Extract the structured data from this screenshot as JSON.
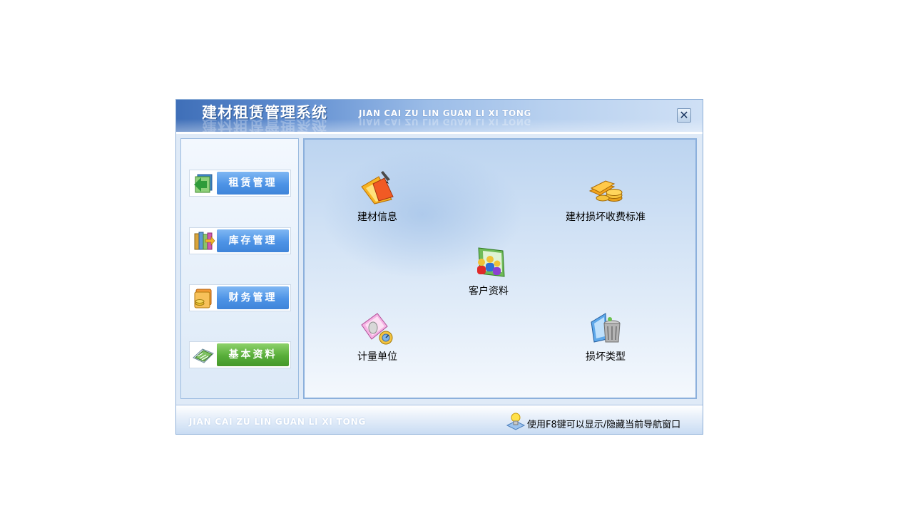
{
  "window": {
    "title_cn": "建材租赁管理系统",
    "title_en": "JIAN CAI ZU LIN GUAN LI XI TONG",
    "close_symbol": "✕"
  },
  "sidebar": {
    "items": [
      {
        "label": "租赁管理",
        "icon": "rental-icon",
        "active": false
      },
      {
        "label": "库存管理",
        "icon": "inventory-icon",
        "active": false
      },
      {
        "label": "财务管理",
        "icon": "finance-icon",
        "active": false
      },
      {
        "label": "基本资料",
        "icon": "basic-data-icon",
        "active": true
      }
    ]
  },
  "content": {
    "items": [
      {
        "label": "建材信息",
        "icon": "building-material-icon"
      },
      {
        "label": "建材损坏收费标准",
        "icon": "coins-icon"
      },
      {
        "label": "客户资料",
        "icon": "customers-icon"
      },
      {
        "label": "计量单位",
        "icon": "measure-unit-icon"
      },
      {
        "label": "损坏类型",
        "icon": "trash-icon"
      }
    ]
  },
  "footer": {
    "watermark": "JIAN CAI ZU LIN GUAN LI XI TONG",
    "tip": "使用F8键可以显示/隐藏当前导航窗口",
    "tip_icon": "lightbulb-icon"
  },
  "colors": {
    "title_bar": "#5f8dd0",
    "nav_button": "#4d93e6",
    "nav_button_active": "#57ad39",
    "content_bg": "#d6e5f6"
  }
}
